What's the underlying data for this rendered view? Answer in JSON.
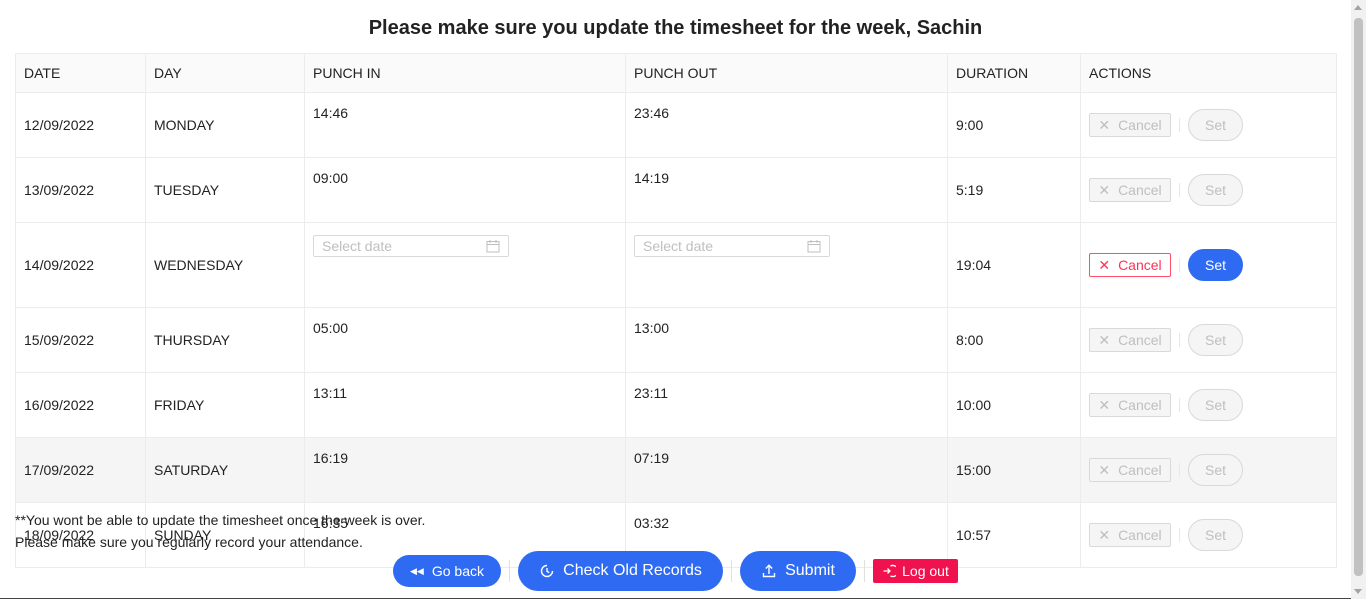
{
  "page": {
    "title": "Please make sure you update the timesheet for the week, Sachin"
  },
  "table": {
    "headers": [
      "DATE",
      "DAY",
      "PUNCH IN",
      "PUNCH OUT",
      "DURATION",
      "ACTIONS"
    ],
    "rows": [
      {
        "date": "12/09/2022",
        "day": "MONDAY",
        "punch_in": "14:46",
        "punch_out": "23:46",
        "duration": "9:00"
      },
      {
        "date": "13/09/2022",
        "day": "TUESDAY",
        "punch_in": "09:00",
        "punch_out": "14:19",
        "duration": "5:19"
      },
      {
        "date": "14/09/2022",
        "day": "WEDNESDAY",
        "punch_in_placeholder": "Select date",
        "punch_out_placeholder": "Select date",
        "duration": "19:04"
      },
      {
        "date": "15/09/2022",
        "day": "THURSDAY",
        "punch_in": "05:00",
        "punch_out": "13:00",
        "duration": "8:00"
      },
      {
        "date": "16/09/2022",
        "day": "FRIDAY",
        "punch_in": "13:11",
        "punch_out": "23:11",
        "duration": "10:00"
      },
      {
        "date": "17/09/2022",
        "day": "SATURDAY",
        "punch_in": "16:19",
        "punch_out": "07:19",
        "duration": "15:00"
      },
      {
        "date": "18/09/2022",
        "day": "SUNDAY",
        "punch_in": "16:35",
        "punch_out": "03:32",
        "duration": "10:57"
      }
    ],
    "cancel_label": "Cancel",
    "set_label": "Set"
  },
  "notes": {
    "line1": "**You wont be able to update the timesheet once the week is over.",
    "line2": "Please make sure you regularly record your attendance."
  },
  "buttons": {
    "go_back": "Go back",
    "check_old_records": "Check Old Records",
    "submit": "Submit",
    "log_out": "Log out"
  },
  "colors": {
    "primary": "#2f6bf2",
    "danger": "#f0124f"
  }
}
